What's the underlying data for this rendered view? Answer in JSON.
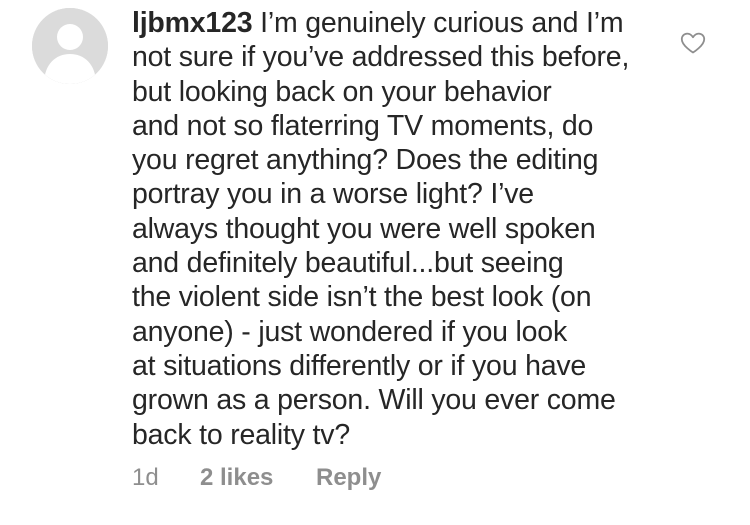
{
  "comment": {
    "username": "ljbmx123",
    "lines": [
      "I’m genuinely curious and I’m",
      "not sure if you’ve addressed this before,",
      "but looking back on your behavior",
      "and not so flaterring TV moments, do",
      "you regret anything? Does the editing",
      "portray you in a worse light? I’ve",
      "always thought you were well spoken",
      "and definitely beautiful...but seeing",
      "the violent side isn’t the best look (on",
      "anyone) - just wondered if you look",
      "at situations differently or if you have",
      "grown as a person. Will you ever come",
      "back to reality tv?"
    ],
    "time": "1d",
    "likes": "2 likes",
    "reply_label": "Reply",
    "avatar_icon": "default-user-avatar-icon",
    "like_icon": "heart-outline-icon"
  },
  "colors": {
    "text": "#262626",
    "meta": "#8e8e8e",
    "avatar_bg": "#dbdbdb",
    "avatar_figure": "#ffffff"
  }
}
